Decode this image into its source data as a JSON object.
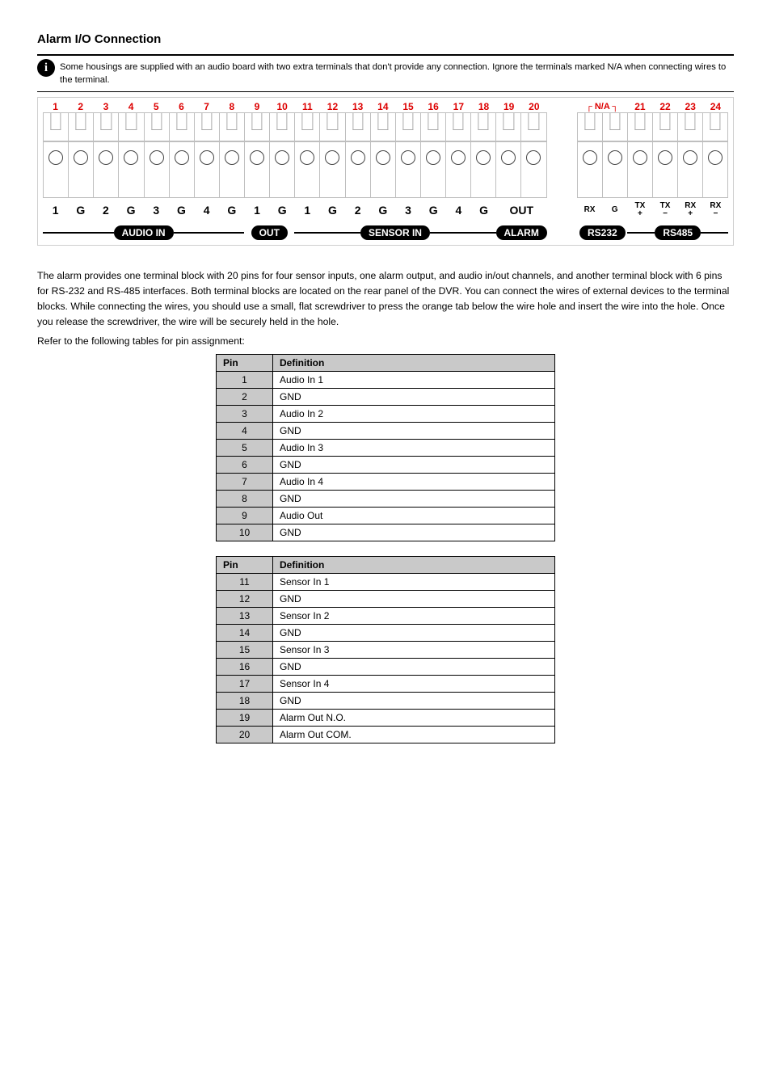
{
  "section_title": "Alarm I/O Connection",
  "info_text": "Some housings are supplied with an audio board with two extra terminals that don't provide any connection. Ignore the terminals marked N/A when connecting wires to the terminal.",
  "terminal_numbers_left": [
    "1",
    "2",
    "3",
    "4",
    "5",
    "6",
    "7",
    "8",
    "9",
    "10",
    "11",
    "12",
    "13",
    "14",
    "15",
    "16",
    "17",
    "18",
    "19",
    "20"
  ],
  "terminal_numbers_right_label": "N/A",
  "terminal_numbers_right": [
    "21",
    "22",
    "23",
    "24"
  ],
  "bottom_labels_left": [
    "1",
    "G",
    "2",
    "G",
    "3",
    "G",
    "4",
    "G",
    "1",
    "G",
    "1",
    "G",
    "2",
    "G",
    "3",
    "G",
    "4",
    "G",
    "OUT",
    ""
  ],
  "bottom_labels_right": [
    "RX",
    "G",
    "TX\n+",
    "TX\n−",
    "RX\n+",
    "RX\n−"
  ],
  "group_labels": [
    "AUDIO IN",
    "OUT",
    "SENSOR IN",
    "ALARM",
    "RS232",
    "RS485"
  ],
  "paragraph1": "The alarm provides one terminal block with 20 pins for four sensor inputs, one alarm output, and audio in/out channels, and another terminal block with 6 pins for RS-232 and RS-485 interfaces. Both terminal blocks are located on the rear panel of the DVR. You can connect the wires of external devices to the terminal blocks. While connecting the wires, you should use a small, flat screwdriver to press the orange tab below the wire hole and insert the wire into the hole. Once you release the screwdriver, the wire will be securely held in the hole.",
  "paragraph2": "Refer to the following tables for pin assignment:",
  "table1": {
    "headers": [
      "Pin",
      "Definition"
    ],
    "rows": [
      [
        "1",
        "Audio In 1"
      ],
      [
        "2",
        "GND"
      ],
      [
        "3",
        "Audio In 2"
      ],
      [
        "4",
        "GND"
      ],
      [
        "5",
        "Audio In 3"
      ],
      [
        "6",
        "GND"
      ],
      [
        "7",
        "Audio In 4"
      ],
      [
        "8",
        "GND"
      ],
      [
        "9",
        "Audio Out"
      ],
      [
        "10",
        "GND"
      ]
    ]
  },
  "table2": {
    "headers": [
      "Pin",
      "Definition"
    ],
    "rows": [
      [
        "11",
        "Sensor In 1"
      ],
      [
        "12",
        "GND"
      ],
      [
        "13",
        "Sensor In 2"
      ],
      [
        "14",
        "GND"
      ],
      [
        "15",
        "Sensor In 3"
      ],
      [
        "16",
        "GND"
      ],
      [
        "17",
        "Sensor In 4"
      ],
      [
        "18",
        "GND"
      ],
      [
        "19",
        "Alarm Out N.O."
      ],
      [
        "20",
        "Alarm Out COM."
      ]
    ]
  }
}
